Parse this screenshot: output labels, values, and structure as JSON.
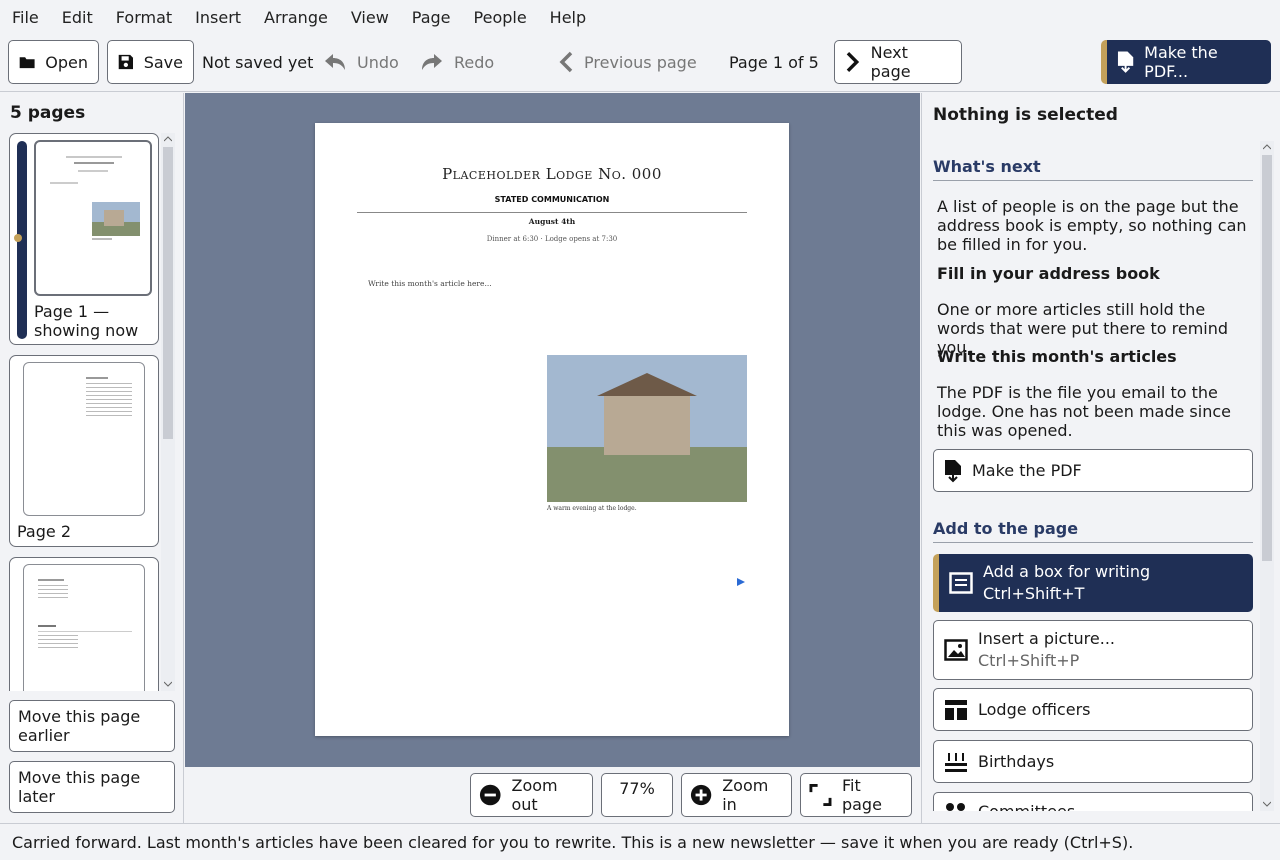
{
  "menu": [
    "File",
    "Edit",
    "Format",
    "Insert",
    "Arrange",
    "View",
    "Page",
    "People",
    "Help"
  ],
  "toolbar": {
    "open_label": "Open",
    "save_label": "Save",
    "save_status": "Not saved yet",
    "undo_label": "Undo",
    "redo_label": "Redo",
    "prev_label": "Previous page",
    "page_indicator": "Page 1 of 5",
    "next_label": "Next page",
    "make_pdf_label": "Make the PDF..."
  },
  "pages_panel": {
    "title": "5 pages",
    "pages": [
      {
        "label": "Page 1 — showing now",
        "current": true
      },
      {
        "label": "Page 2",
        "current": false
      },
      {
        "label": "",
        "current": false
      }
    ],
    "move_earlier": "Move this page earlier",
    "move_later": "Move this page later"
  },
  "page": {
    "lodge_name": "Placeholder Lodge No. 000",
    "subtitle": "STATED COMMUNICATION",
    "date": "August 4th",
    "times": "Dinner at 6:30 · Lodge opens at 7:30",
    "article_placeholder": "Write this month's article here...",
    "caption": "A warm evening at the lodge."
  },
  "zoom": {
    "zoom_out": "Zoom out",
    "level": "77%",
    "zoom_in": "Zoom in",
    "fit": "Fit page"
  },
  "inspector": {
    "title": "Nothing is selected",
    "whats_next": "What's next",
    "tip1": "A list of people is on the page but the address book is empty, so nothing can be filled in for you.",
    "tip1_action": "Fill in your address book",
    "tip2": "One or more articles still hold the words that were put there to remind you.",
    "tip2_action": "Write this month's articles",
    "tip3": "The PDF is the file you email to the lodge. One has not been made since this was opened.",
    "make_pdf": "Make the PDF",
    "add_section": "Add to the page",
    "add_text_box": "Add a box for writing",
    "add_text_box_shortcut": "Ctrl+Shift+T",
    "insert_picture": "Insert a picture...",
    "insert_picture_shortcut": "Ctrl+Shift+P",
    "officers": "Lodge officers",
    "birthdays": "Birthdays",
    "committees": "Committees"
  },
  "status": "Carried forward. Last month's articles have been cleared for you to rewrite. This is a new newsletter — save it when you are ready (Ctrl+S).",
  "colors": {
    "accent": "#1f2f55",
    "gold": "#c4a15a",
    "canvas": "#6e7b93"
  }
}
